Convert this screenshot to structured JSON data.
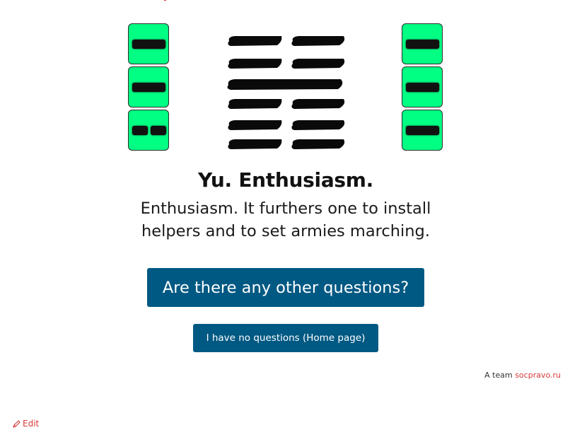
{
  "hexagram": {
    "lines": [
      "broken",
      "broken",
      "solid",
      "broken",
      "broken",
      "broken"
    ],
    "lower_trigram": [
      "solid",
      "solid",
      "broken"
    ],
    "upper_trigram": [
      "solid",
      "solid",
      "solid"
    ]
  },
  "title": "Yu. Enthusiasm.",
  "description": "Enthusiasm. It furthers one to install helpers and to set armies marching.",
  "buttons": {
    "other_questions": "Are there any other questions?",
    "no_questions": "I have no questions (Home page)"
  },
  "credit": {
    "prefix": "A team",
    "link": "socpravo.ru"
  },
  "edit": {
    "label": "Edit",
    "icon": "pencil-icon"
  },
  "colors": {
    "tile_green": "#00ff83",
    "button_blue": "#005983",
    "link_red": "#d9383a"
  }
}
